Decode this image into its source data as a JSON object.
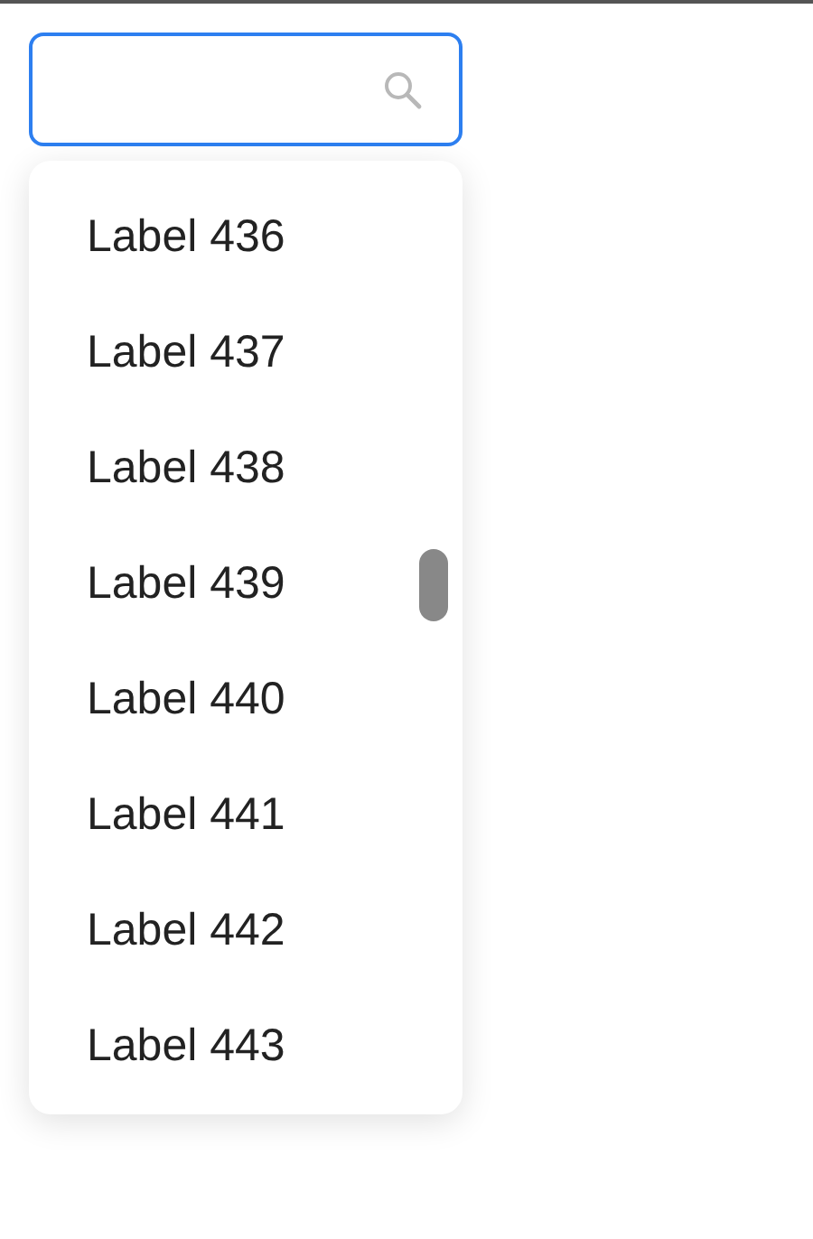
{
  "search": {
    "focused": true
  },
  "options": [
    {
      "label": "Label 436"
    },
    {
      "label": "Label 437"
    },
    {
      "label": "Label 438"
    },
    {
      "label": "Label 439"
    },
    {
      "label": "Label 440"
    },
    {
      "label": "Label 441"
    },
    {
      "label": "Label 442"
    },
    {
      "label": "Label 443"
    }
  ]
}
